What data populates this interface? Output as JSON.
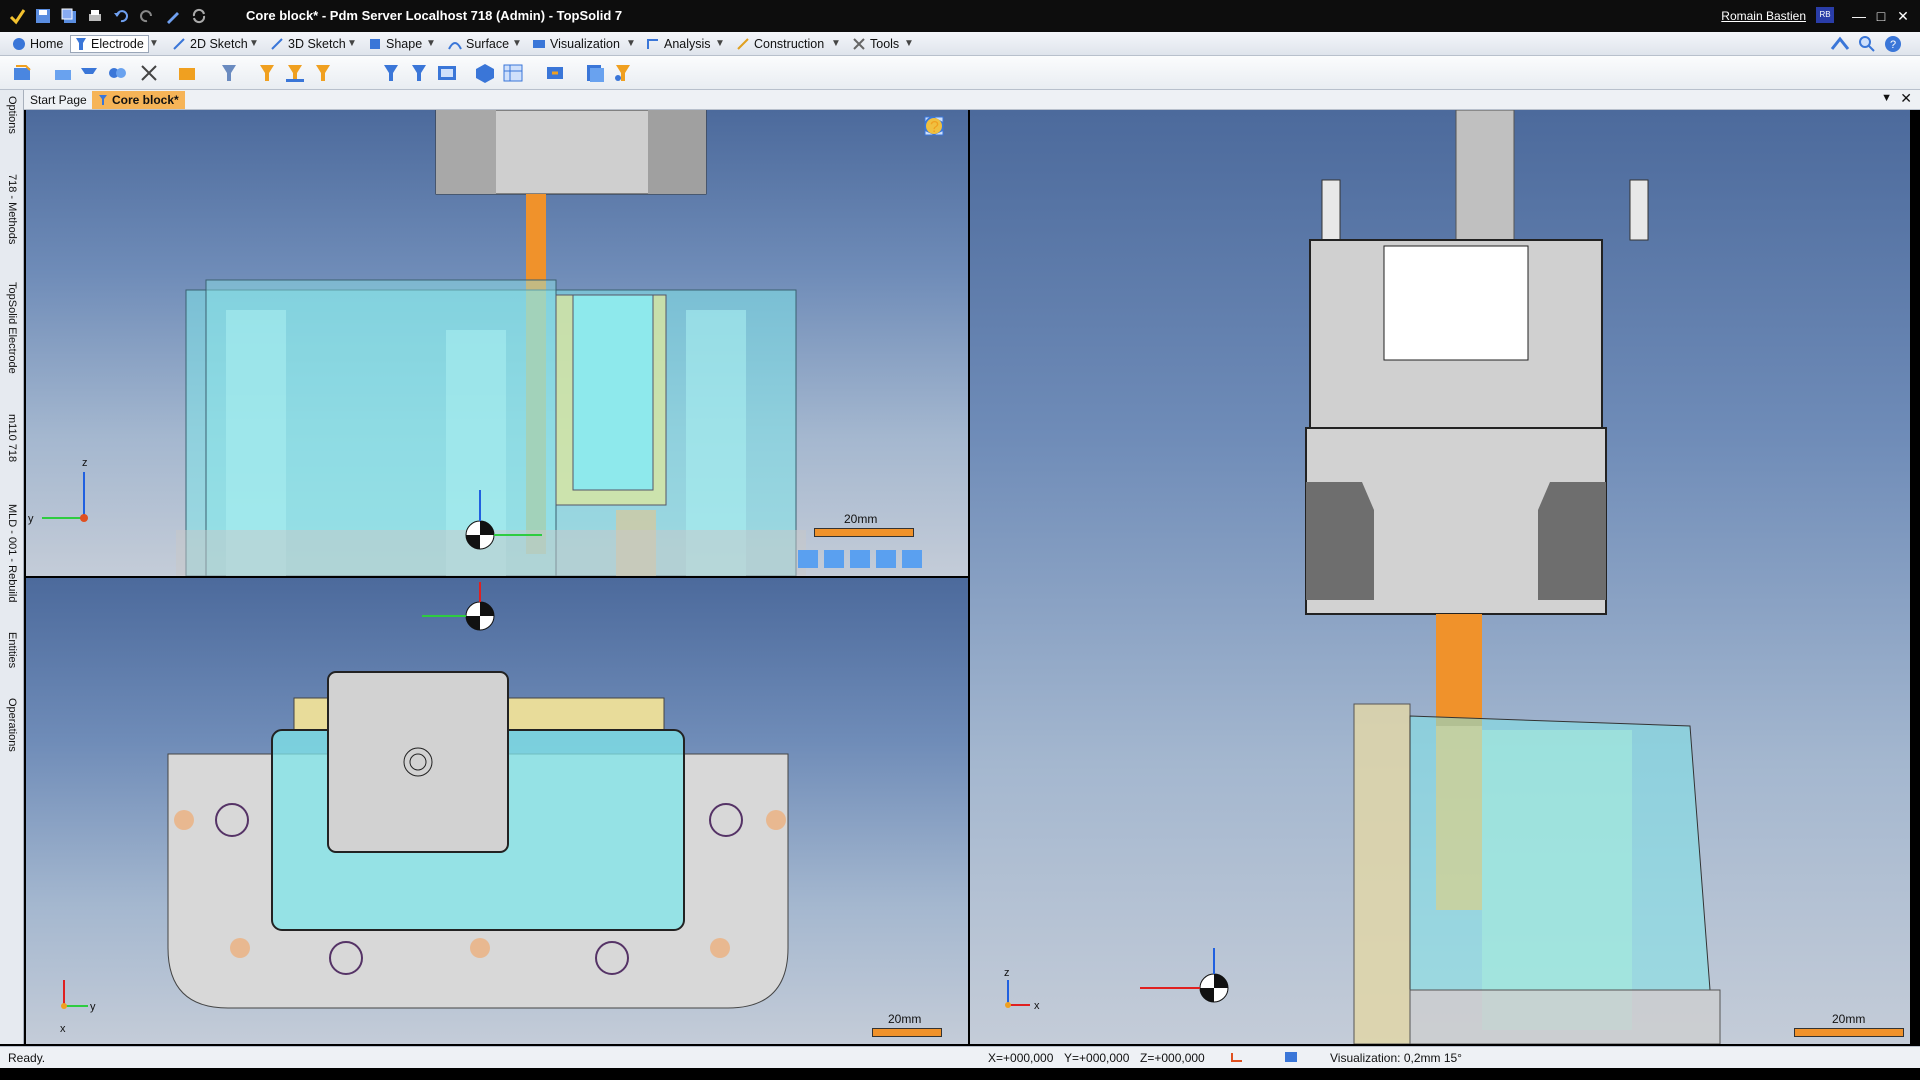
{
  "window": {
    "title": "Core block* - Pdm Server Localhost 718 (Admin) - TopSolid 7",
    "user": "Romain Bastien",
    "user_initials": "RB"
  },
  "menu": {
    "items": [
      "Home",
      "Electrode",
      "2D Sketch",
      "3D Sketch",
      "Shape",
      "Surface",
      "Visualization",
      "Analysis",
      "Construction",
      "Tools"
    ],
    "active": "Electrode"
  },
  "tabs": {
    "start": "Start Page",
    "active": "Core block*"
  },
  "left_dock": {
    "items": [
      "Options",
      "718 - Methods",
      "TopSolid Electrode",
      "m110 718",
      "MLD - 001 - Rebuild",
      "Entities",
      "Operations"
    ]
  },
  "viewports": {
    "front": {
      "scale": "20mm",
      "axis_z": "z",
      "axis_y": "y"
    },
    "top": {
      "scale": "20mm",
      "axis_y": "y",
      "axis_x": "x"
    },
    "side": {
      "scale": "20mm",
      "axis_z": "z",
      "axis_x": "x"
    }
  },
  "status": {
    "ready": "Ready.",
    "x": "X=+000,000",
    "y": "Y=+000,000",
    "z": "Z=+000,000",
    "visualization": "Visualization: 0,2mm 15°"
  },
  "colors": {
    "accent_tab": "#f6b457",
    "electrode_orange": "#f0922b",
    "cyan_part": "#7fe6ea",
    "grey_part": "#d2d2d2"
  }
}
